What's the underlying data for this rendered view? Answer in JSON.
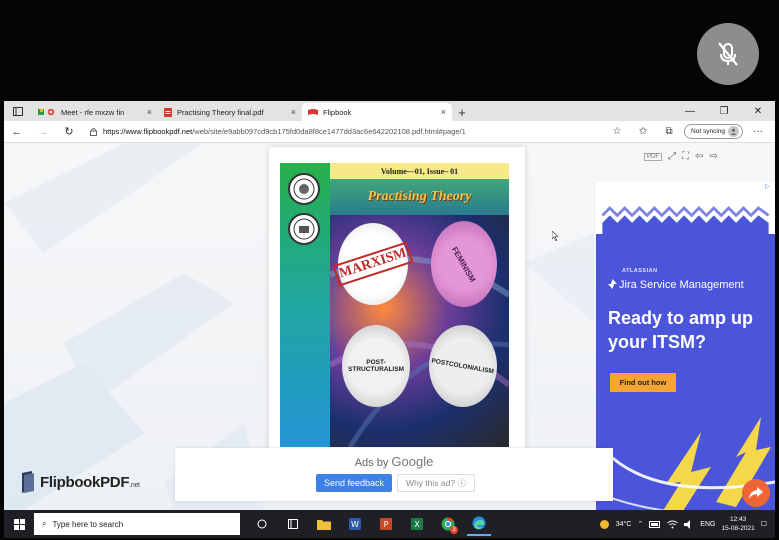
{
  "meeting": {
    "mic_icon": "mic-muted-icon"
  },
  "tabs": [
    {
      "label": "Meet - rfe mxzw fin",
      "icon": "meet-icon",
      "close": "×",
      "active": false
    },
    {
      "label": "Practising Theory final.pdf",
      "icon": "pdf-icon",
      "close": "×",
      "active": false
    },
    {
      "label": "Flipbook",
      "icon": "flipbook-icon",
      "close": "×",
      "active": true
    }
  ],
  "new_tab": "+",
  "window_controls": {
    "minimize": "—",
    "restore": "❐",
    "close": "✕"
  },
  "toolbar": {
    "url_host": "https://www.flipbookpdf.net",
    "url_path": "/web/site/e9abb097cd9cb175fd0da8f8ce1477dd3ac6e642202108.pdf.html#page/1",
    "sync_label": "Not syncing",
    "more": "···"
  },
  "book": {
    "volume": "Volume—01, Issue– 01",
    "title": "Practising Theory",
    "topics": [
      "MARXISM",
      "FEMINISM",
      "POST-STRUCTURALISM",
      "POSTCOLONIALISM"
    ]
  },
  "viewer_tools": {
    "pdf": "PDF"
  },
  "ad": {
    "brand": "ATLASSIAN",
    "product": "Jira Service Management",
    "headline": "Ready to amp up your ITSM?",
    "cta": "Find out how"
  },
  "ads_by_google": {
    "label": "Ads by",
    "brand": "Google",
    "feedback": "Send feedback",
    "why": "Why this ad?"
  },
  "logo": {
    "name": "FlipbookPDF",
    "tld": ".net"
  },
  "taskbar": {
    "search_placeholder": "Type here to search",
    "weather": "34°C",
    "lang": "ENG",
    "time": "12:43",
    "date": "15-08-2021",
    "mail_badge": "3"
  },
  "colors": {
    "ad_bg": "#4b55d9",
    "cta": "#f7a432",
    "share": "#f06536",
    "feedback": "#3e81e6"
  }
}
